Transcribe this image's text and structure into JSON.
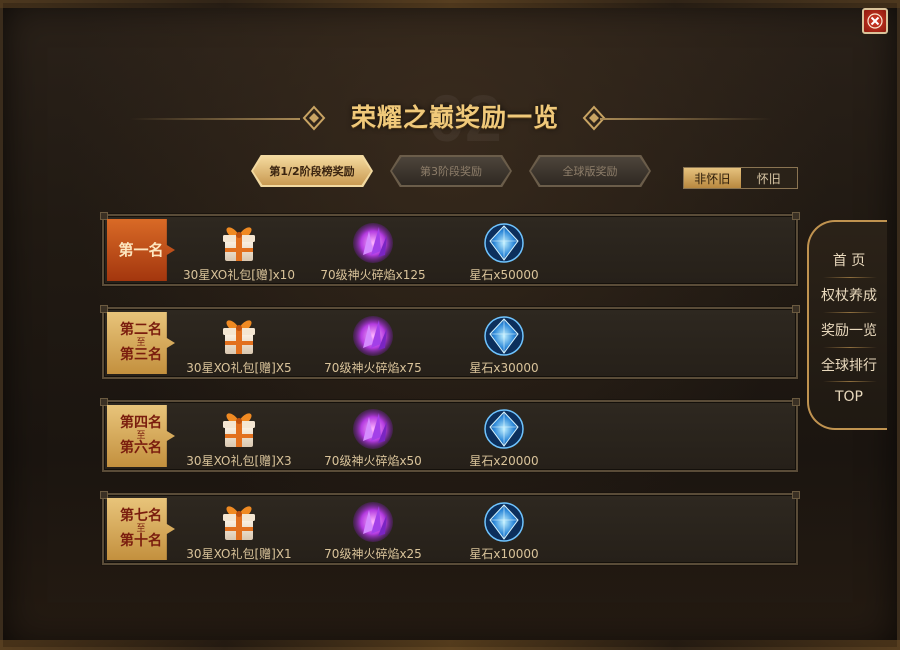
{
  "window": {
    "close_icon": "close-icon"
  },
  "header": {
    "title": "荣耀之巅奖励一览",
    "watermark": "02"
  },
  "tabs": [
    {
      "label": "第1/2阶段榜奖励",
      "active": true
    },
    {
      "label": "第3阶段奖励",
      "active": false
    },
    {
      "label": "全球版奖励",
      "active": false
    }
  ],
  "toggle": {
    "on_label": "非怀旧",
    "off_label": "怀旧"
  },
  "ranks": [
    {
      "line1": "第一名",
      "zhi": "",
      "line2": "",
      "rewards": [
        "30星XO礼包[赠]x10",
        "70级神火碎焰x125",
        "星石x50000"
      ]
    },
    {
      "line1": "第二名",
      "zhi": "至",
      "line2": "第三名",
      "rewards": [
        "30星XO礼包[赠]X5",
        "70级神火碎焰x75",
        "星石x30000"
      ]
    },
    {
      "line1": "第四名",
      "zhi": "至",
      "line2": "第六名",
      "rewards": [
        "30星XO礼包[赠]X3",
        "70级神火碎焰x50",
        "星石x20000"
      ]
    },
    {
      "line1": "第七名",
      "zhi": "至",
      "line2": "第十名",
      "rewards": [
        "30星XO礼包[赠]X1",
        "70级神火碎焰x25",
        "星石x10000"
      ]
    }
  ],
  "reward_icons": [
    "gift-box-icon",
    "purple-crystal-icon",
    "blue-star-stone-icon"
  ],
  "sidenav": {
    "items": [
      "首 页",
      "权杖养成",
      "奖励一览",
      "全球排行",
      "TOP"
    ]
  },
  "colors": {
    "accent_gold": "#f0c97a",
    "first_rank": "#c24a16",
    "rank_gold": "#d6a95c"
  }
}
